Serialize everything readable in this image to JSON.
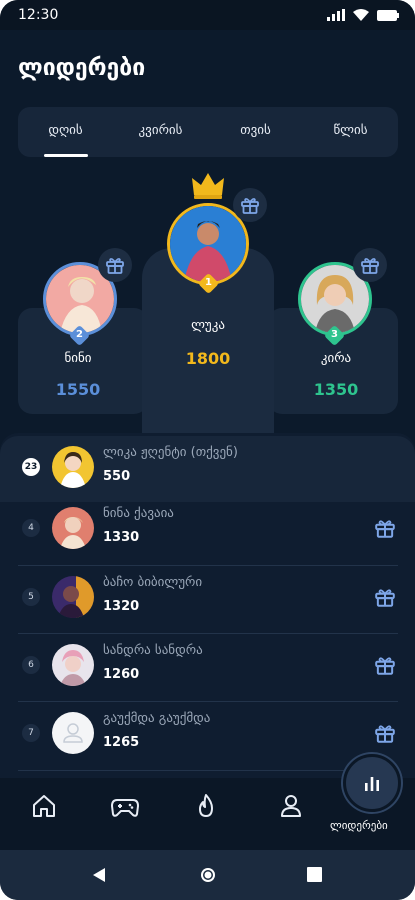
{
  "status": {
    "time": "12:30"
  },
  "title": "ლიდერები",
  "tabs": [
    {
      "label": "დღის",
      "active": true
    },
    {
      "label": "კვირის",
      "active": false
    },
    {
      "label": "თვის",
      "active": false
    },
    {
      "label": "წლის",
      "active": false
    }
  ],
  "podium": {
    "first": {
      "rank": "1",
      "name": "ლუკა",
      "score": "1800",
      "color": "#f2b81c"
    },
    "second": {
      "rank": "2",
      "name": "ნინი",
      "score": "1550",
      "color": "#5b8fd9"
    },
    "third": {
      "rank": "3",
      "name": "კირა",
      "score": "1350",
      "color": "#2ec48e"
    }
  },
  "list": [
    {
      "rank": "23",
      "name": "ლიკა ჟღენტი (თქვენ)",
      "score": "550",
      "gift": false
    },
    {
      "rank": "4",
      "name": "ნინა ქავაია",
      "score": "1330",
      "gift": true
    },
    {
      "rank": "5",
      "name": "ბაჩო ბიბილური",
      "score": "1320",
      "gift": true
    },
    {
      "rank": "6",
      "name": "სანდრა სანდრა",
      "score": "1260",
      "gift": true
    },
    {
      "rank": "7",
      "name": "გაუქმდა გაუქმდა",
      "score": "1265",
      "gift": true
    }
  ],
  "nav": {
    "items": [
      "home-icon",
      "gamepad-icon",
      "fire-icon",
      "profile-icon"
    ],
    "active_label": "ლიდერები"
  },
  "colors": {
    "background": "#0c1a2b",
    "gift": "#7ea6e8",
    "accent_gold": "#f2b81c"
  }
}
